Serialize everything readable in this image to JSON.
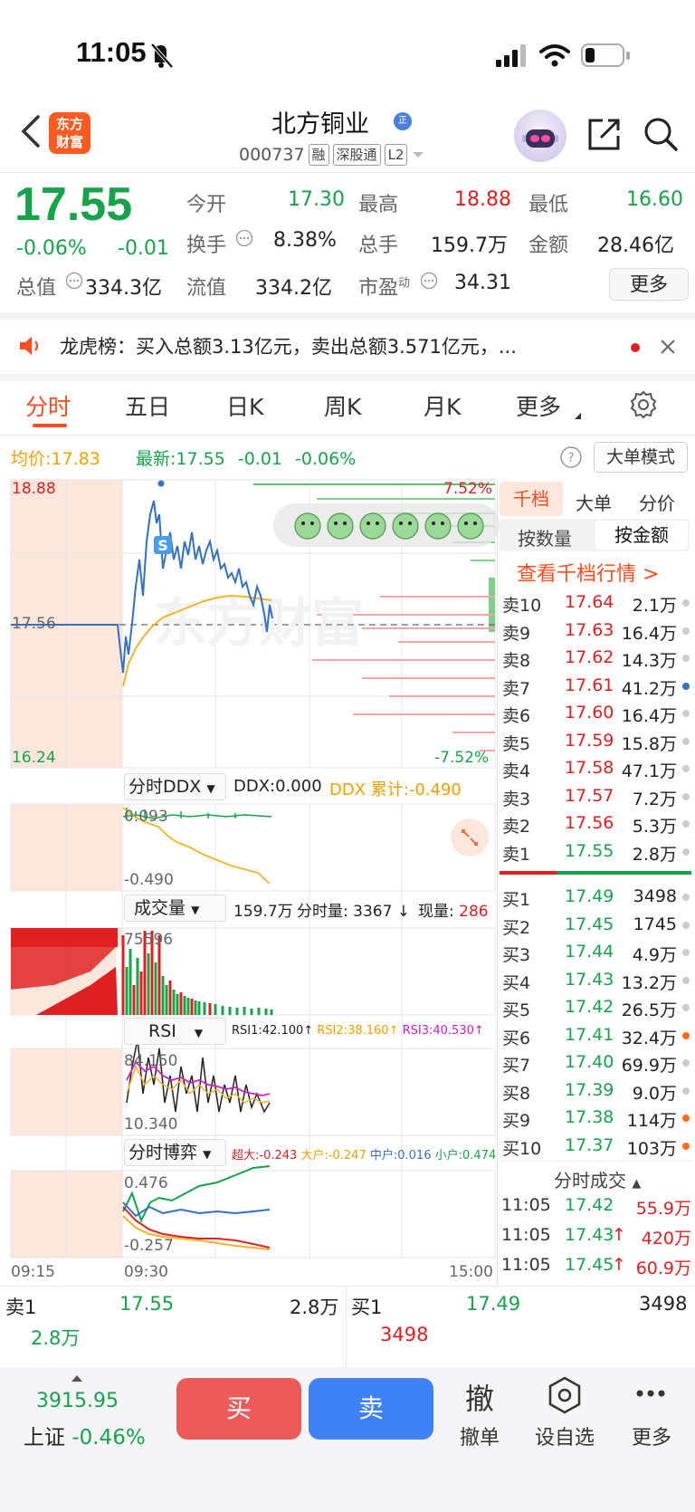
{
  "status_bar": {
    "time": "11:05"
  },
  "header": {
    "stock_name": "北方铜业",
    "name_badge": "正",
    "code": "000737",
    "tags": [
      "融",
      "深股通",
      "L2"
    ],
    "logo_text": "东方\n财富"
  },
  "quote": {
    "price": "17.55",
    "change_pct": "-0.06%",
    "change": "-0.01",
    "open_label": "今开",
    "open": "17.30",
    "high_label": "最高",
    "high": "18.88",
    "low_label": "最低",
    "low": "16.60",
    "turnover_label": "换手",
    "turnover": "8.38%",
    "volume_label": "总手",
    "volume": "159.7万",
    "amount_label": "金额",
    "amount": "28.46亿",
    "total_mv_label": "总值",
    "total_mv": "334.3亿",
    "float_mv_label": "流值",
    "float_mv": "334.2亿",
    "pe_label": "市盈",
    "pe_sup": "动",
    "pe": "34.31",
    "more_label": "更多"
  },
  "notice": {
    "text": "龙虎榜：买入总额3.13亿元，卖出总额3.571亿元，..."
  },
  "tabs": [
    "分时",
    "五日",
    "日K",
    "周K",
    "月K",
    "更多"
  ],
  "chart_header": {
    "avg_label": "均价:",
    "avg": "17.83",
    "latest_label": "最新:",
    "latest": "17.55",
    "latest_chg": "-0.01",
    "latest_pct": "-0.06%",
    "mode_label": "大单模式"
  },
  "main_chart": {
    "y_top": "18.88",
    "y_mid": "17.56",
    "y_bottom": "16.24",
    "pct_top": "7.52%",
    "pct_bottom": "-7.52%",
    "watermark": "东方财富",
    "marker": "S"
  },
  "ddx": {
    "selector": "分时DDX",
    "ddx_label": "DDX:0.000",
    "ddx_sum": "DDX 累计:-0.490",
    "top": "0.093",
    "bottom": "-0.490"
  },
  "volume": {
    "selector": "成交量",
    "total": "159.7万",
    "detail": "分时量: 3367",
    "now_label": "现量:",
    "now": "286",
    "top": "75596"
  },
  "rsi": {
    "selector": "RSI",
    "rsi1": "RSI1:42.100",
    "rsi2": "RSI2:38.160",
    "rsi3": "RSI3:40.530",
    "top": "84.150",
    "bottom": "10.340"
  },
  "game": {
    "selector": "分时博弈",
    "super": "超大:-0.243",
    "large": "大户:-0.247",
    "mid": "中户:0.016",
    "small": "小户:0.474",
    "top": "0.476",
    "bottom": "-0.257"
  },
  "time_axis": [
    "09:15",
    "09:30",
    "15:00"
  ],
  "book_tabs": [
    "千档",
    "大单",
    "分价"
  ],
  "book_subtabs": [
    "按数量",
    "按金额"
  ],
  "book_link": "查看千档行情 >",
  "sells": [
    {
      "label": "卖10",
      "price": "17.64",
      "vol": "2.1万"
    },
    {
      "label": "卖9",
      "price": "17.63",
      "vol": "16.4万"
    },
    {
      "label": "卖8",
      "price": "17.62",
      "vol": "14.3万"
    },
    {
      "label": "卖7",
      "price": "17.61",
      "vol": "41.2万"
    },
    {
      "label": "卖6",
      "price": "17.60",
      "vol": "16.4万"
    },
    {
      "label": "卖5",
      "price": "17.59",
      "vol": "15.8万"
    },
    {
      "label": "卖4",
      "price": "17.58",
      "vol": "47.1万"
    },
    {
      "label": "卖3",
      "price": "17.57",
      "vol": "7.2万"
    },
    {
      "label": "卖2",
      "price": "17.56",
      "vol": "5.3万"
    },
    {
      "label": "卖1",
      "price": "17.55",
      "vol": "2.8万"
    }
  ],
  "buys": [
    {
      "label": "买1",
      "price": "17.49",
      "vol": "3498"
    },
    {
      "label": "买2",
      "price": "17.45",
      "vol": "1745"
    },
    {
      "label": "买3",
      "price": "17.44",
      "vol": "4.9万"
    },
    {
      "label": "买4",
      "price": "17.43",
      "vol": "13.2万"
    },
    {
      "label": "买5",
      "price": "17.42",
      "vol": "26.5万"
    },
    {
      "label": "买6",
      "price": "17.41",
      "vol": "32.4万"
    },
    {
      "label": "买7",
      "price": "17.40",
      "vol": "69.9万"
    },
    {
      "label": "买8",
      "price": "17.39",
      "vol": "9.0万"
    },
    {
      "label": "买9",
      "price": "17.38",
      "vol": "114万"
    },
    {
      "label": "买10",
      "price": "17.37",
      "vol": "103万"
    }
  ],
  "trades_header": "分时成交",
  "trades": [
    {
      "time": "11:05",
      "price": "17.42",
      "vol": "55.9万"
    },
    {
      "time": "11:05",
      "price": "17.43",
      "vol": "420万"
    },
    {
      "time": "11:05",
      "price": "17.45",
      "vol": "60.9万"
    }
  ],
  "bottom_quote": {
    "sell_label": "卖1",
    "sell_price": "17.55",
    "sell_vol": "2.8万",
    "sell_vol2": "2.8万",
    "buy_label": "买1",
    "buy_price": "17.49",
    "buy_vol": "3498",
    "buy_vol2": "3498"
  },
  "bottom_bar": {
    "index_value": "3915.95",
    "index_name": "上证",
    "index_pct": "-0.46%",
    "buy": "买",
    "sell": "卖",
    "cancel_glyph": "撤",
    "cancel": "撤单",
    "watch": "设自选",
    "more": "更多"
  }
}
